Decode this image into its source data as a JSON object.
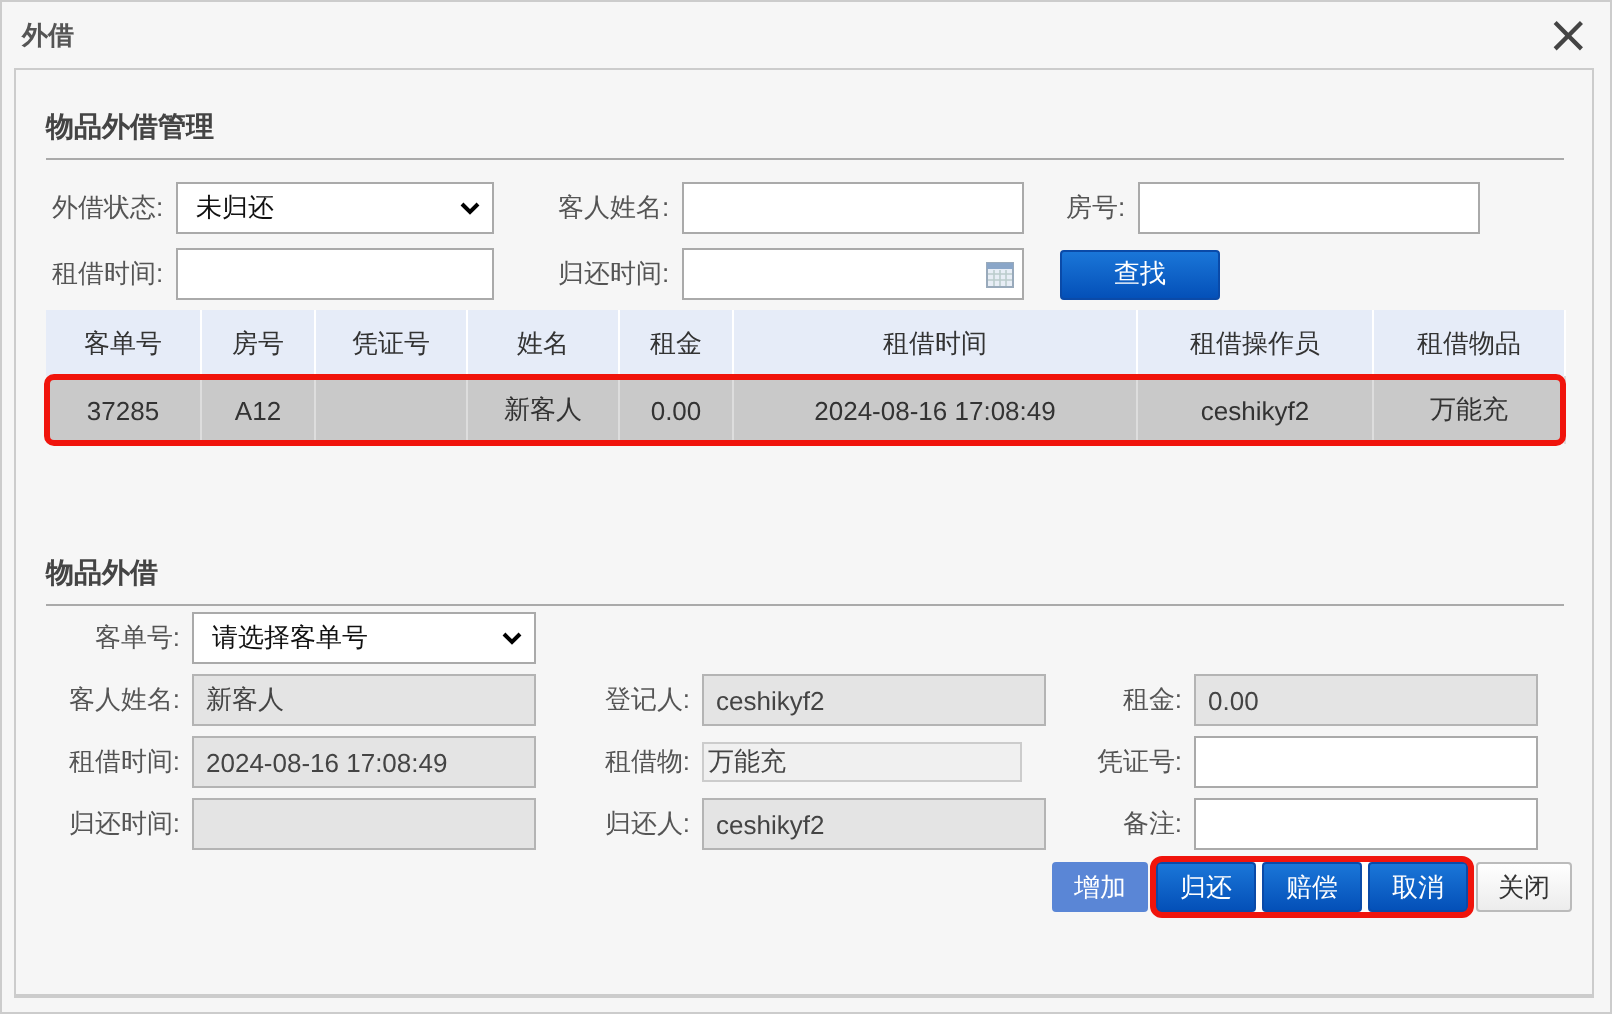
{
  "window": {
    "title": "外借",
    "close": "×"
  },
  "search_section": {
    "title": "物品外借管理",
    "status": {
      "label": "外借状态:",
      "value": "未归还"
    },
    "guest_name": {
      "label": "客人姓名:"
    },
    "room": {
      "label": "房号:"
    },
    "rent_time": {
      "label": "租借时间:"
    },
    "return_time": {
      "label": "归还时间:"
    },
    "search_button": "查找"
  },
  "table": {
    "columns": [
      "客单号",
      "房号",
      "凭证号",
      "姓名",
      "租金",
      "租借时间",
      "租借操作员",
      "租借物品"
    ],
    "rows": [
      {
        "cells": [
          "37285",
          "A12",
          "",
          "新客人",
          "0.00",
          "2024-08-16 17:08:49",
          "ceshikyf2",
          "万能充"
        ],
        "selected": true,
        "highlighted": true
      }
    ]
  },
  "form_section": {
    "title": "物品外借",
    "order": {
      "label": "客单号:",
      "value": "请选择客单号"
    },
    "fields": [
      {
        "label": "客人姓名:",
        "value": "新客人",
        "readonly": true
      },
      {
        "label": "登记人:",
        "value": "ceshikyf2",
        "readonly": true
      },
      {
        "label": "租金:",
        "value": "0.00",
        "readonly": true
      },
      {
        "label": "租借时间:",
        "value": "2024-08-16 17:08:49",
        "readonly": true
      },
      {
        "label": "租借物:",
        "value": "万能充",
        "readonly": true,
        "kind": "short"
      },
      {
        "label": "凭证号:",
        "readonly": false
      },
      {
        "label": "归还时间:",
        "readonly": true
      },
      {
        "label": "归还人:",
        "value": "ceshikyf2",
        "readonly": true
      },
      {
        "label": "备注:",
        "readonly": false
      }
    ]
  },
  "button_groups": [
    {
      "highlighted": false,
      "buttons": [
        {
          "label": "增加",
          "kind": "primary",
          "disabled": true
        }
      ]
    },
    {
      "highlighted": true,
      "buttons": [
        {
          "label": "归还",
          "kind": "primary",
          "disabled": false
        },
        {
          "label": "赔偿",
          "kind": "primary",
          "disabled": false
        },
        {
          "label": "取消",
          "kind": "primary",
          "disabled": false
        }
      ]
    },
    {
      "highlighted": false,
      "buttons": [
        {
          "label": "关闭",
          "kind": "plain",
          "disabled": false
        }
      ]
    }
  ]
}
